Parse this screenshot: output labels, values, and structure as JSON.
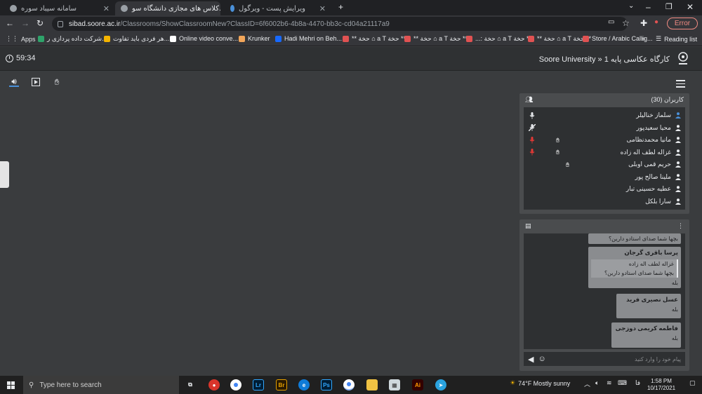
{
  "browser": {
    "tabs": [
      {
        "title": "سامانه سیباد سوره",
        "active": false
      },
      {
        "title": "کلاس های مجازی دانشگاه سو...",
        "active": true
      },
      {
        "title": "ویرایش پست - ویرگول",
        "active": false
      }
    ],
    "new_tab": "+",
    "url_host": "sibad.soore.ac.ir",
    "url_path": "/Classrooms/ShowClassroomNew?ClassID=6f6002b6-4b8a-4470-bb3c-cd04a21117a9",
    "error_label": "Error"
  },
  "bookmarks": [
    {
      "label": "Apps",
      "color": "#e8eaed"
    },
    {
      "label": "شرکت داده پردازی ر...",
      "color": "#2ea36a"
    },
    {
      "label": "هر فردی باید تفاوت...",
      "color": "#f4b400"
    },
    {
      "label": "Online video conve...",
      "color": "#ffffff"
    },
    {
      "label": "Krunker",
      "color": "#f2a65a"
    },
    {
      "label": "Hadi Mehri on Beh...",
      "color": "#1769ff"
    },
    {
      "label": "** حخة ⌂ a T حخة **",
      "color": "#e05252"
    },
    {
      "label": "** حخة ⌂ a T حخة **",
      "color": "#e05252"
    },
    {
      "label": "...: حخة ⌂ a T حخة **",
      "color": "#e05252"
    },
    {
      "label": "** حخة ⌂ a T حخة **",
      "color": "#e05252"
    },
    {
      "label": "Store / Arabic Callig...",
      "color": "#e05252"
    },
    {
      "label": "»",
      "color": "#e8eaed"
    },
    {
      "label": "Reading list",
      "color": "#e8eaed"
    }
  ],
  "header": {
    "timer": "59:34",
    "class_title": "Soore University » کارگاه عکاسی پایه 1"
  },
  "users": {
    "title": "کاربران (30)",
    "list": [
      {
        "name": "سلماز خنالیلر",
        "mic": "white",
        "hand": false,
        "color": "#4a90d9"
      },
      {
        "name": "محیا سعیدپور",
        "mic": "muted",
        "hand": false,
        "color": "#e8eaed"
      },
      {
        "name": "مانیا محمدنظامی",
        "mic": "red",
        "hand": true,
        "color": "#e8eaed"
      },
      {
        "name": "غزاله لطف اله زاده",
        "mic": "red",
        "hand": true,
        "color": "#e8eaed"
      },
      {
        "name": "حریم قمی اوبلی",
        "mic": "none",
        "hand": true,
        "color": "#e8eaed"
      },
      {
        "name": "ملینا صالح پور",
        "mic": "none",
        "hand": false,
        "color": "#e8eaed"
      },
      {
        "name": "عطیه حسینی تبار",
        "mic": "none",
        "hand": false,
        "color": "#e8eaed"
      },
      {
        "name": "سارا بلکل",
        "mic": "none",
        "hand": false,
        "color": "#e8eaed"
      }
    ]
  },
  "chat": {
    "messages": [
      {
        "sender": "",
        "quote_name": "",
        "quote_text": "",
        "text": "بچها شما صدای استادو دارین؟"
      },
      {
        "sender": "پرسا باقری گرجان",
        "quote_name": "غزاله لطف اله زاده",
        "quote_text": "بچها شما صدای استادو دارین؟",
        "text": "بله"
      },
      {
        "sender": "عسل نصیری فرید",
        "quote_name": "",
        "quote_text": "",
        "text": "بله"
      },
      {
        "sender": "فاطمه کریمی دوزجی",
        "quote_name": "",
        "quote_text": "",
        "text": "بله"
      }
    ],
    "input_placeholder": "پیام خود را وارد کنید"
  },
  "taskbar": {
    "search_placeholder": "Type here to search",
    "weather": "74°F  Mostly sunny",
    "lang": "فا",
    "time": "1:58 PM",
    "date": "10/17/2021"
  }
}
